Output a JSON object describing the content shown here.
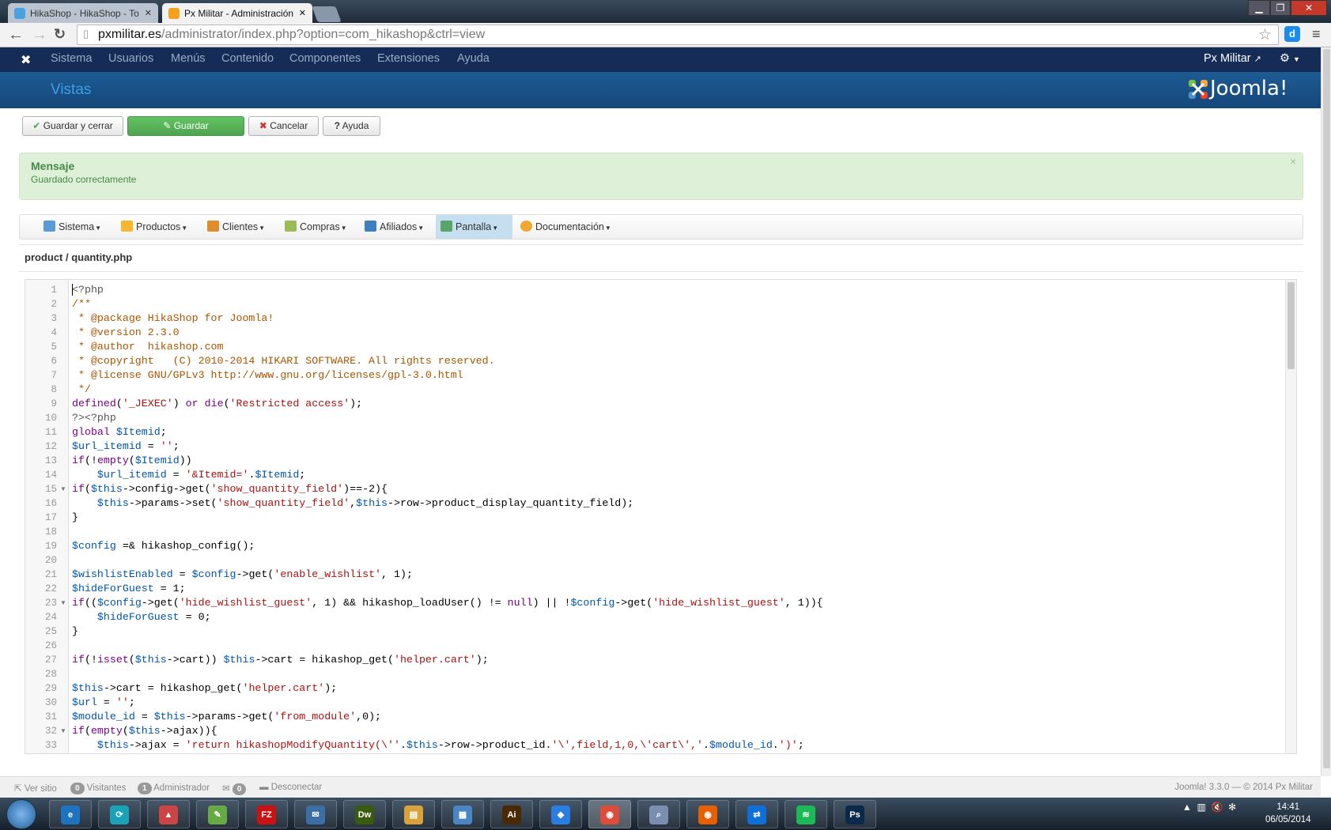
{
  "browser": {
    "tabs": [
      {
        "label": "HikaShop - HikaShop - To",
        "icon": "hikashop-favicon",
        "color": "#4aa3df"
      },
      {
        "label": "Px Militar - Administración",
        "icon": "joomla-favicon",
        "color": "#f4a21d",
        "active": true
      }
    ],
    "url_host": "pxmilitar.es",
    "url_path": "/administrator/index.php?option=com_hikashop&ctrl=view",
    "extension_label": "d"
  },
  "joomla": {
    "menu": [
      "Sistema",
      "Usuarios",
      "Menús",
      "Contenido",
      "Componentes",
      "Extensiones",
      "Ayuda"
    ],
    "site_link": "Px Militar",
    "page_title": "Vistas",
    "logo_text": "Joomla!"
  },
  "toolbar": [
    {
      "label": "Guardar y cerrar",
      "icon": "check-icon",
      "glyph": "✔"
    },
    {
      "label": "Guardar",
      "icon": "edit-icon",
      "glyph": "✎",
      "primary": true
    },
    {
      "label": "Cancelar",
      "icon": "cancel-icon",
      "glyph": "✖"
    },
    {
      "label": "Ayuda",
      "icon": "help-icon",
      "glyph": "?"
    }
  ],
  "message": {
    "title": "Mensaje",
    "text": "Guardado correctamente",
    "close": "×"
  },
  "hikashop_menu": [
    {
      "label": "Sistema",
      "color": "#5b9bd5"
    },
    {
      "label": "Productos",
      "color": "#f5b82e"
    },
    {
      "label": "Clientes",
      "color": "#e08b2c"
    },
    {
      "label": "Compras",
      "color": "#9bbb59"
    },
    {
      "label": "Afiliados",
      "color": "#3f7fbf"
    },
    {
      "label": "Pantalla",
      "color": "#5aa469",
      "active": true
    },
    {
      "label": "Documentación",
      "color": "#f0a830"
    }
  ],
  "file_title": "product / quantity.php",
  "code": {
    "fold_lines": [
      15,
      23,
      32
    ],
    "comment_lines": [
      2,
      3,
      4,
      5,
      6,
      7,
      8
    ],
    "lines": [
      "<?php",
      "/**",
      " * @package HikaShop for Joomla!",
      " * @version 2.3.0",
      " * @author  hikashop.com",
      " * @copyright   (C) 2010-2014 HIKARI SOFTWARE. All rights reserved.",
      " * @license GNU/GPLv3 http://www.gnu.org/licenses/gpl-3.0.html",
      " */",
      "defined('_JEXEC') or die('Restricted access');",
      "?><?php",
      "global $Itemid;",
      "$url_itemid = '';",
      "if(!empty($Itemid))",
      "    $url_itemid = '&Itemid='.$Itemid;",
      "if($this->config->get('show_quantity_field')==-2){",
      "    $this->params->set('show_quantity_field',$this->row->product_display_quantity_field);",
      "}",
      "",
      "$config =& hikashop_config();",
      "",
      "$wishlistEnabled = $config->get('enable_wishlist', 1);",
      "$hideForGuest = 1;",
      "if(($config->get('hide_wishlist_guest', 1) && hikashop_loadUser() != null) || !$config->get('hide_wishlist_guest', 1)){",
      "    $hideForGuest = 0;",
      "}",
      "",
      "if(!isset($this->cart)) $this->cart = hikashop_get('helper.cart');",
      "",
      "$this->cart = hikashop_get('helper.cart');",
      "$url = '';",
      "$module_id = $this->params->get('from_module',0);",
      "if(empty($this->ajax)){",
      "    $this->ajax = 'return hikashopModifyQuantity(\\''.$this->row->product_id.'\\',field,1,0,\\'cart\\','.$module_id.')';"
    ]
  },
  "footer": {
    "view_site": "Ver sitio",
    "visitors_count": "0",
    "visitors": "Visitantes",
    "admins_count": "1",
    "admins": "Administrador",
    "messages_count": "0",
    "logout": "Desconectar",
    "version": "Joomla! 3.3.0  —  © 2014 Px Militar"
  },
  "taskbar": {
    "apps": [
      {
        "name": "internet-explorer",
        "label": "e",
        "color": "#1e73be"
      },
      {
        "name": "app-cyan",
        "label": "⟳",
        "color": "#1aa3b8"
      },
      {
        "name": "color-app",
        "label": "▲",
        "color": "#c44"
      },
      {
        "name": "notepad-plus",
        "label": "✎",
        "color": "#6a4"
      },
      {
        "name": "filezilla",
        "label": "FZ",
        "color": "#c11"
      },
      {
        "name": "thunderbird",
        "label": "✉",
        "color": "#3b6ea5"
      },
      {
        "name": "dreamweaver",
        "label": "Dw",
        "color": "#3a5a10"
      },
      {
        "name": "file-explorer",
        "label": "▤",
        "color": "#d9a23a"
      },
      {
        "name": "control-panel",
        "label": "▦",
        "color": "#4a86c5"
      },
      {
        "name": "illustrator",
        "label": "Ai",
        "color": "#4a2a05"
      },
      {
        "name": "dropbox",
        "label": "◆",
        "color": "#2a7de1"
      },
      {
        "name": "chrome",
        "label": "◉",
        "color": "#dd4b39",
        "active": true
      },
      {
        "name": "search-app",
        "label": "⌕",
        "color": "#7a8fb0"
      },
      {
        "name": "firefox",
        "label": "◉",
        "color": "#e66000"
      },
      {
        "name": "teamviewer",
        "label": "⇄",
        "color": "#0e6fd8"
      },
      {
        "name": "spotify",
        "label": "≋",
        "color": "#1db954"
      },
      {
        "name": "photoshop",
        "label": "Ps",
        "color": "#0b2a4a"
      }
    ],
    "time": "14:41",
    "date": "06/05/2014"
  }
}
